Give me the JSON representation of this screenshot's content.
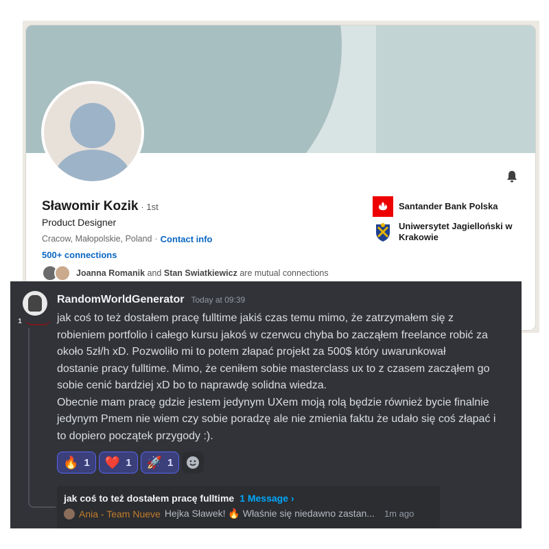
{
  "linkedin": {
    "name": "Sławomir Kozik",
    "degree": "· 1st",
    "headline": "Product Designer",
    "location": "Cracow, Małopolskie, Poland",
    "separator": "·",
    "contact_info": "Contact info",
    "connections": "500+ connections",
    "mutual": {
      "person1": "Joanna Romanik",
      "and": "and",
      "person2": "Stan Swiatkiewicz",
      "suffix": "are mutual connections"
    },
    "companies": [
      {
        "name": "Santander Bank Polska"
      },
      {
        "name": "Uniwersytet Jagielloński w Krakowie"
      }
    ],
    "icons": {
      "bell": "bell-icon",
      "santander": "santander-logo",
      "uj": "uj-crest-logo"
    },
    "colors": {
      "link": "#0a66c2",
      "banner": "#a8bfc1",
      "santander": "#ec0000"
    }
  },
  "discord": {
    "username": "RandomWorldGenerator",
    "timestamp": "Today at 09:39",
    "avatar_badge": "1",
    "message_lines": [
      "jak coś to też dostałem pracę fulltime jakiś czas temu mimo, że zatrzymałem się z",
      "robieniem portfolio i całego kursu jakoś w czerwcu chyba bo zacząłem freelance robić za",
      "około 5zł/h xD. Pozwoliło mi to potem złapać projekt za 500$ który uwarunkował",
      "dostanie pracy fulltime. Mimo, że ceniłem sobie masterclass ux to z czasem zacząłem go",
      "sobie cenić bardziej xD bo to naprawdę solidna wiedza.",
      "Obecnie mam pracę gdzie jestem jedynym UXem moją rolą będzie również bycie finalnie",
      "jedynym Pmem nie wiem czy sobie poradzę ale nie zmienia faktu że udało się coś złapać i",
      "to dopiero początek przygody :)."
    ],
    "reactions": [
      {
        "emoji": "🔥",
        "icon": "fire-emoji",
        "count": "1"
      },
      {
        "emoji": "❤️",
        "icon": "heart-emoji",
        "count": "1"
      },
      {
        "emoji": "🚀",
        "icon": "rocket-emoji",
        "count": "1"
      }
    ],
    "thread": {
      "title": "jak coś to też dostałem pracę fulltime",
      "count": "1 Message ›",
      "author": "Ania - Team Nueve",
      "preview": "Hejka Sławek! 🔥 Właśnie się niedawno zastan...",
      "ago": "1m ago"
    },
    "colors": {
      "background": "#313338",
      "reaction_bg": "#3b3f7a",
      "reaction_border": "#5865f2",
      "thread_link": "#00a8fc"
    }
  }
}
